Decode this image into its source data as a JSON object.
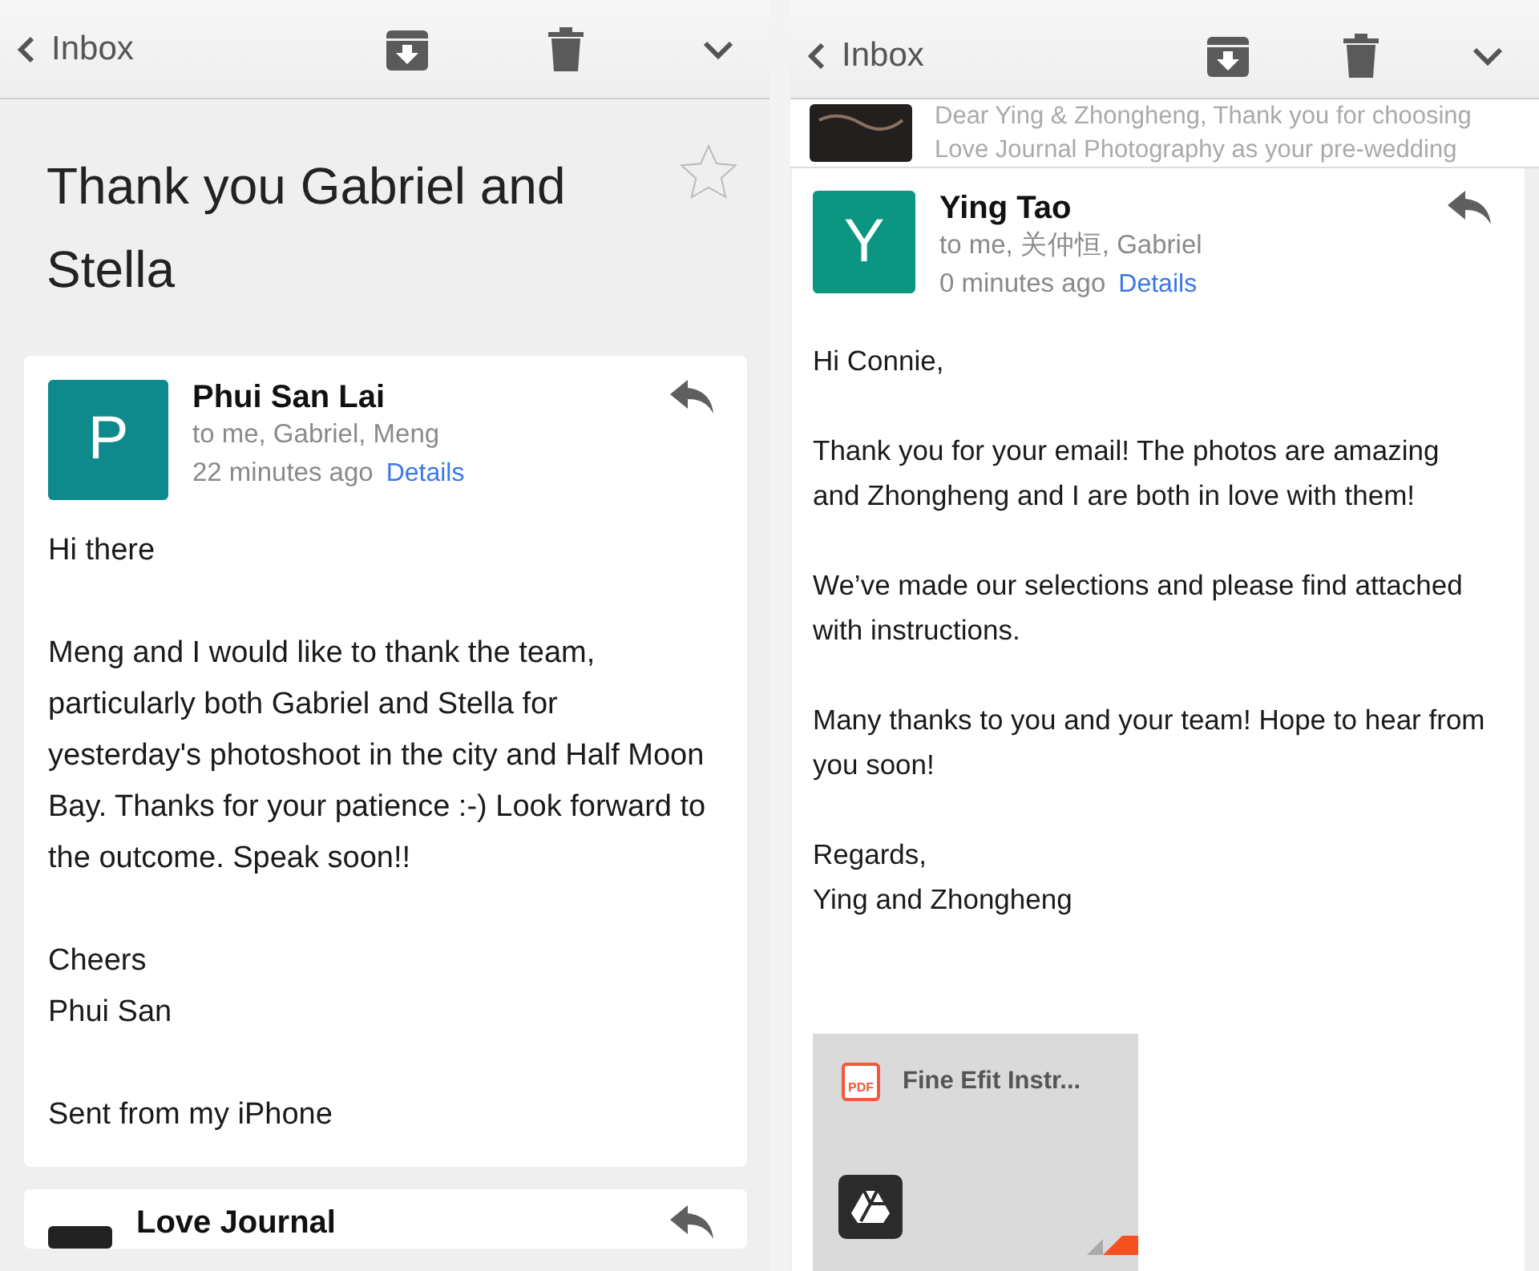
{
  "left_pane": {
    "toolbar": {
      "back_label": "Inbox"
    },
    "subject": "Thank you Gabriel and Stella",
    "starred": false,
    "message": {
      "avatar_letter": "P",
      "color": "#0e8a8c",
      "sender": "Phui San Lai",
      "recipients": "to me, Gabriel, Meng",
      "time": "22 minutes ago",
      "details_link": "Details",
      "body": [
        "Hi there",
        "Meng and I would like to thank the team, particularly both Gabriel and Stella for yesterday's photoshoot in the city and Half Moon Bay. Thanks for your patience :-) Look forward to the outcome. Speak soon!!",
        "Cheers\nPhui San",
        "Sent from my iPhone"
      ]
    },
    "next_message": {
      "sender": "Love Journal"
    }
  },
  "right_pane": {
    "toolbar": {
      "back_label": "Inbox"
    },
    "previous_message": {
      "snippet": "Dear Ying & Zhongheng, Thank you for choosing Love Journal Photography as your pre-wedding"
    },
    "message": {
      "avatar_letter": "Y",
      "color": "#0b9682",
      "sender": "Ying Tao",
      "recipients": "to me, 关仲恒, Gabriel",
      "time": "0 minutes ago",
      "details_link": "Details",
      "body": [
        "Hi Connie,",
        "Thank you for your email! The photos are amazing and Zhongheng and I are both in love with them!",
        "We’ve made our selections and please find attached with instructions.",
        "Many thanks to you and your team! Hope to hear from you soon!",
        "Regards,\nYing and Zhongheng"
      ],
      "attachment": {
        "file_type": "PDF",
        "name": "Fine Efit Instr..."
      }
    }
  }
}
